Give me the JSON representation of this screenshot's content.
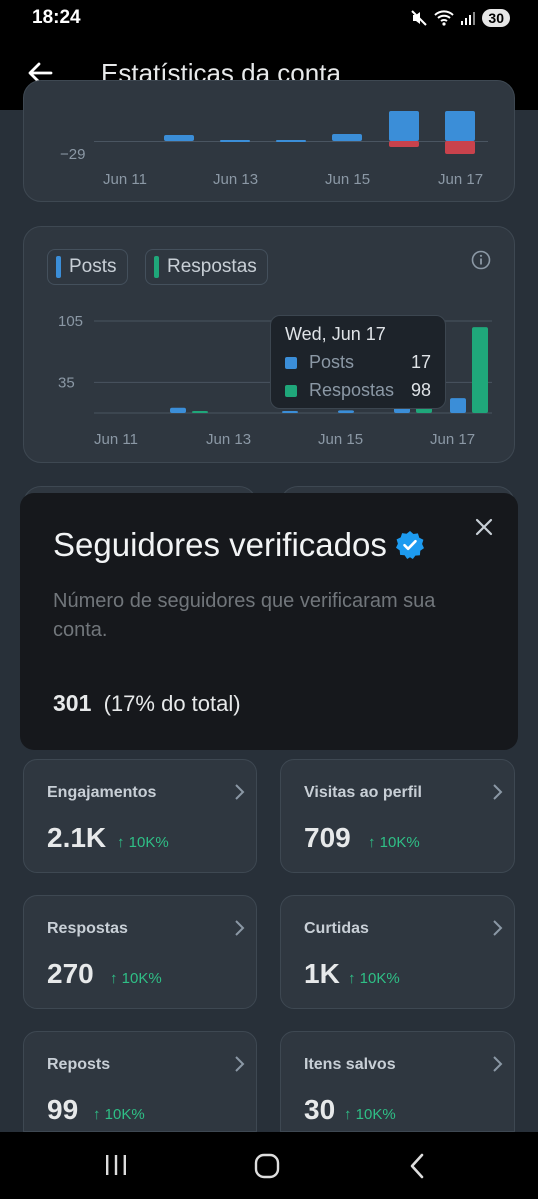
{
  "status_bar": {
    "time": "18:24",
    "battery": "30"
  },
  "app_bar": {
    "title": "Estatísticas da conta"
  },
  "top_chart": {
    "y_tick": "−29",
    "x_ticks": [
      "Jun 11",
      "Jun 13",
      "Jun 15",
      "Jun 17"
    ]
  },
  "chart_data": {
    "type": "bar",
    "legend": [
      "Posts",
      "Respostas"
    ],
    "y_ticks": [
      "105",
      "35"
    ],
    "x_ticks": [
      "Jun 11",
      "Jun 13",
      "Jun 15",
      "Jun 17"
    ],
    "categories": [
      "Jun 11",
      "Jun 12",
      "Jun 13",
      "Jun 14",
      "Jun 15",
      "Jun 16",
      "Jun 17"
    ],
    "series": [
      {
        "name": "Posts",
        "values": [
          0,
          6,
          0,
          2,
          3,
          7,
          17
        ]
      },
      {
        "name": "Respostas",
        "values": [
          0,
          1,
          0,
          0,
          0,
          7,
          98
        ]
      }
    ],
    "ylim": [
      0,
      105
    ],
    "tooltip": {
      "date": "Wed, Jun 17",
      "rows": [
        {
          "label": "Posts",
          "value": "17"
        },
        {
          "label": "Respostas",
          "value": "98"
        }
      ]
    },
    "colors": {
      "posts": "#3b8ed8",
      "respostas": "#1fa77a"
    }
  },
  "popup": {
    "title": "Seguidores verificados",
    "description": "Número de seguidores que verificaram sua conta.",
    "value": "301",
    "value_note": "(17% do total)"
  },
  "stats": [
    {
      "label": "Engajamentos",
      "value": "2.1K",
      "delta": "↑ 10K%"
    },
    {
      "label": "Visitas ao perfil",
      "value": "709",
      "delta": "↑ 10K%"
    },
    {
      "label": "Respostas",
      "value": "270",
      "delta": "↑ 10K%"
    },
    {
      "label": "Curtidas",
      "value": "1K",
      "delta": "↑ 10K%"
    },
    {
      "label": "Reposts",
      "value": "99",
      "delta": "↑ 10K%"
    },
    {
      "label": "Itens salvos",
      "value": "30",
      "delta": "↑ 10K%"
    }
  ]
}
